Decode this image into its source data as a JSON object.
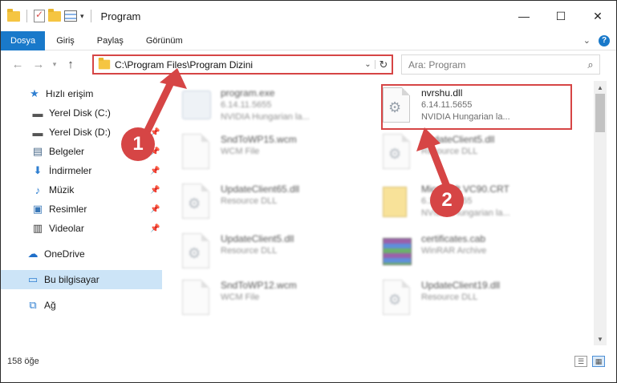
{
  "window": {
    "title": "Program",
    "controls": {
      "minimize": "—",
      "maximize": "☐",
      "close": "✕"
    }
  },
  "ribbon": {
    "tabs": [
      "Dosya",
      "Giriş",
      "Paylaş",
      "Görünüm"
    ]
  },
  "address": {
    "path": "C:\\Program Files\\Program Dizini",
    "search_placeholder": "Ara: Program"
  },
  "sidebar": {
    "items": [
      {
        "label": "Hızlı erişim",
        "icon": "star-icon",
        "pinned": false
      },
      {
        "label": "Yerel Disk (C:)",
        "icon": "drive-icon",
        "pinned": false
      },
      {
        "label": "Yerel Disk (D:)",
        "icon": "drive-icon",
        "pinned": true
      },
      {
        "label": "Belgeler",
        "icon": "documents-icon",
        "pinned": true
      },
      {
        "label": "İndirmeler",
        "icon": "download-icon",
        "pinned": true
      },
      {
        "label": "Müzik",
        "icon": "music-icon",
        "pinned": true
      },
      {
        "label": "Resimler",
        "icon": "pictures-icon",
        "pinned": true
      },
      {
        "label": "Videolar",
        "icon": "videos-icon",
        "pinned": true
      },
      {
        "label": "OneDrive",
        "icon": "cloud-icon",
        "pinned": false
      },
      {
        "label": "Bu bilgisayar",
        "icon": "computer-icon",
        "pinned": false,
        "selected": true
      },
      {
        "label": "Ağ",
        "icon": "network-icon",
        "pinned": false
      }
    ]
  },
  "files": [
    {
      "name": "program.exe",
      "line1": "6.14.11.5655",
      "line2": "NVIDIA Hungarian la...",
      "icon": "exe-icon",
      "blurred": true
    },
    {
      "name": "nvrshu.dll",
      "line1": "6.14.11.5655",
      "line2": "NVIDIA Hungarian la...",
      "icon": "dll-icon",
      "blurred": false
    },
    {
      "name": "SndToWP15.wcm",
      "line1": "WCM File",
      "line2": "",
      "icon": "file-icon",
      "blurred": true
    },
    {
      "name": "UpdateClient5.dll",
      "line1": "Resource DLL",
      "line2": "",
      "icon": "dll-icon",
      "blurred": true
    },
    {
      "name": "UpdateClient65.dll",
      "line1": "Resource DLL",
      "line2": "",
      "icon": "dll-icon",
      "blurred": true
    },
    {
      "name": "Microsoft.VC90.CRT",
      "line1": "6.14.11.5655",
      "line2": "NVIDIA Hungarian la...",
      "icon": "vc-icon",
      "blurred": true
    },
    {
      "name": "UpdateClient5.dll",
      "line1": "Resource DLL",
      "line2": "",
      "icon": "dll-icon",
      "blurred": true
    },
    {
      "name": "certificates.cab",
      "line1": "WinRAR Archive",
      "line2": "",
      "icon": "cab-icon",
      "blurred": true
    },
    {
      "name": "SndToWP12.wcm",
      "line1": "WCM File",
      "line2": "",
      "icon": "file-icon",
      "blurred": true
    },
    {
      "name": "UpdateClient19.dll",
      "line1": "Resource DLL",
      "line2": "",
      "icon": "dll-icon",
      "blurred": true
    }
  ],
  "status": {
    "count": "158 öğe"
  },
  "annotations": {
    "step1": "1",
    "step2": "2",
    "color": "#d64545"
  }
}
